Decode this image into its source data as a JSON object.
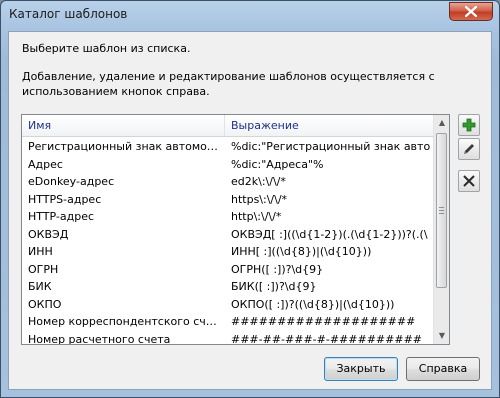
{
  "window": {
    "title": "Каталог шаблонов"
  },
  "instructions": {
    "line1": "Выберите шаблон из списка.",
    "line2": "Добавление, удаление и редактирование шаблонов осуществляется с",
    "line3": "использованием кнопок справа."
  },
  "list": {
    "columns": [
      "Имя",
      "Выражение"
    ],
    "rows": [
      {
        "name": "Регистрационный знак автомобиля",
        "expr": "%dic:\"Регистрационный знак авто"
      },
      {
        "name": "Адрес",
        "expr": "%dic:\"Адреса\"%"
      },
      {
        "name": "eDonkey-адрес",
        "expr": "ed2k\\:\\/\\/*"
      },
      {
        "name": "HTTPS-адрес",
        "expr": "https\\:\\/\\/*"
      },
      {
        "name": "HTTP-адрес",
        "expr": "http\\:\\/\\/*"
      },
      {
        "name": "ОКВЭД",
        "expr": "ОКВЭД[ :]((\\d{1-2})(.(\\d{1-2}))?(.(\\"
      },
      {
        "name": "ИНН",
        "expr": "ИНН[ :]((\\d{8})|(\\d{10}))"
      },
      {
        "name": "ОГРН",
        "expr": "ОГРН([ :])?\\d{9}"
      },
      {
        "name": "БИК",
        "expr": "БИК([ :])?\\d{9}"
      },
      {
        "name": "ОКПО",
        "expr": "ОКПО([ :])?((\\d{8})|(\\d{10}))"
      },
      {
        "name": "Номер корреспондентского счёта",
        "expr": "####################"
      },
      {
        "name": "Номер расчетного счета",
        "expr": "###-##-###-#-##########"
      }
    ]
  },
  "side_buttons": {
    "add": "plus-icon",
    "edit": "pencil-icon",
    "delete": "cross-icon"
  },
  "buttons": {
    "close": "Закрыть",
    "help": "Справка"
  },
  "colors": {
    "add_icon": "#2f9a2f",
    "header_text": "#1e3287",
    "close_button": "#c13d24"
  }
}
